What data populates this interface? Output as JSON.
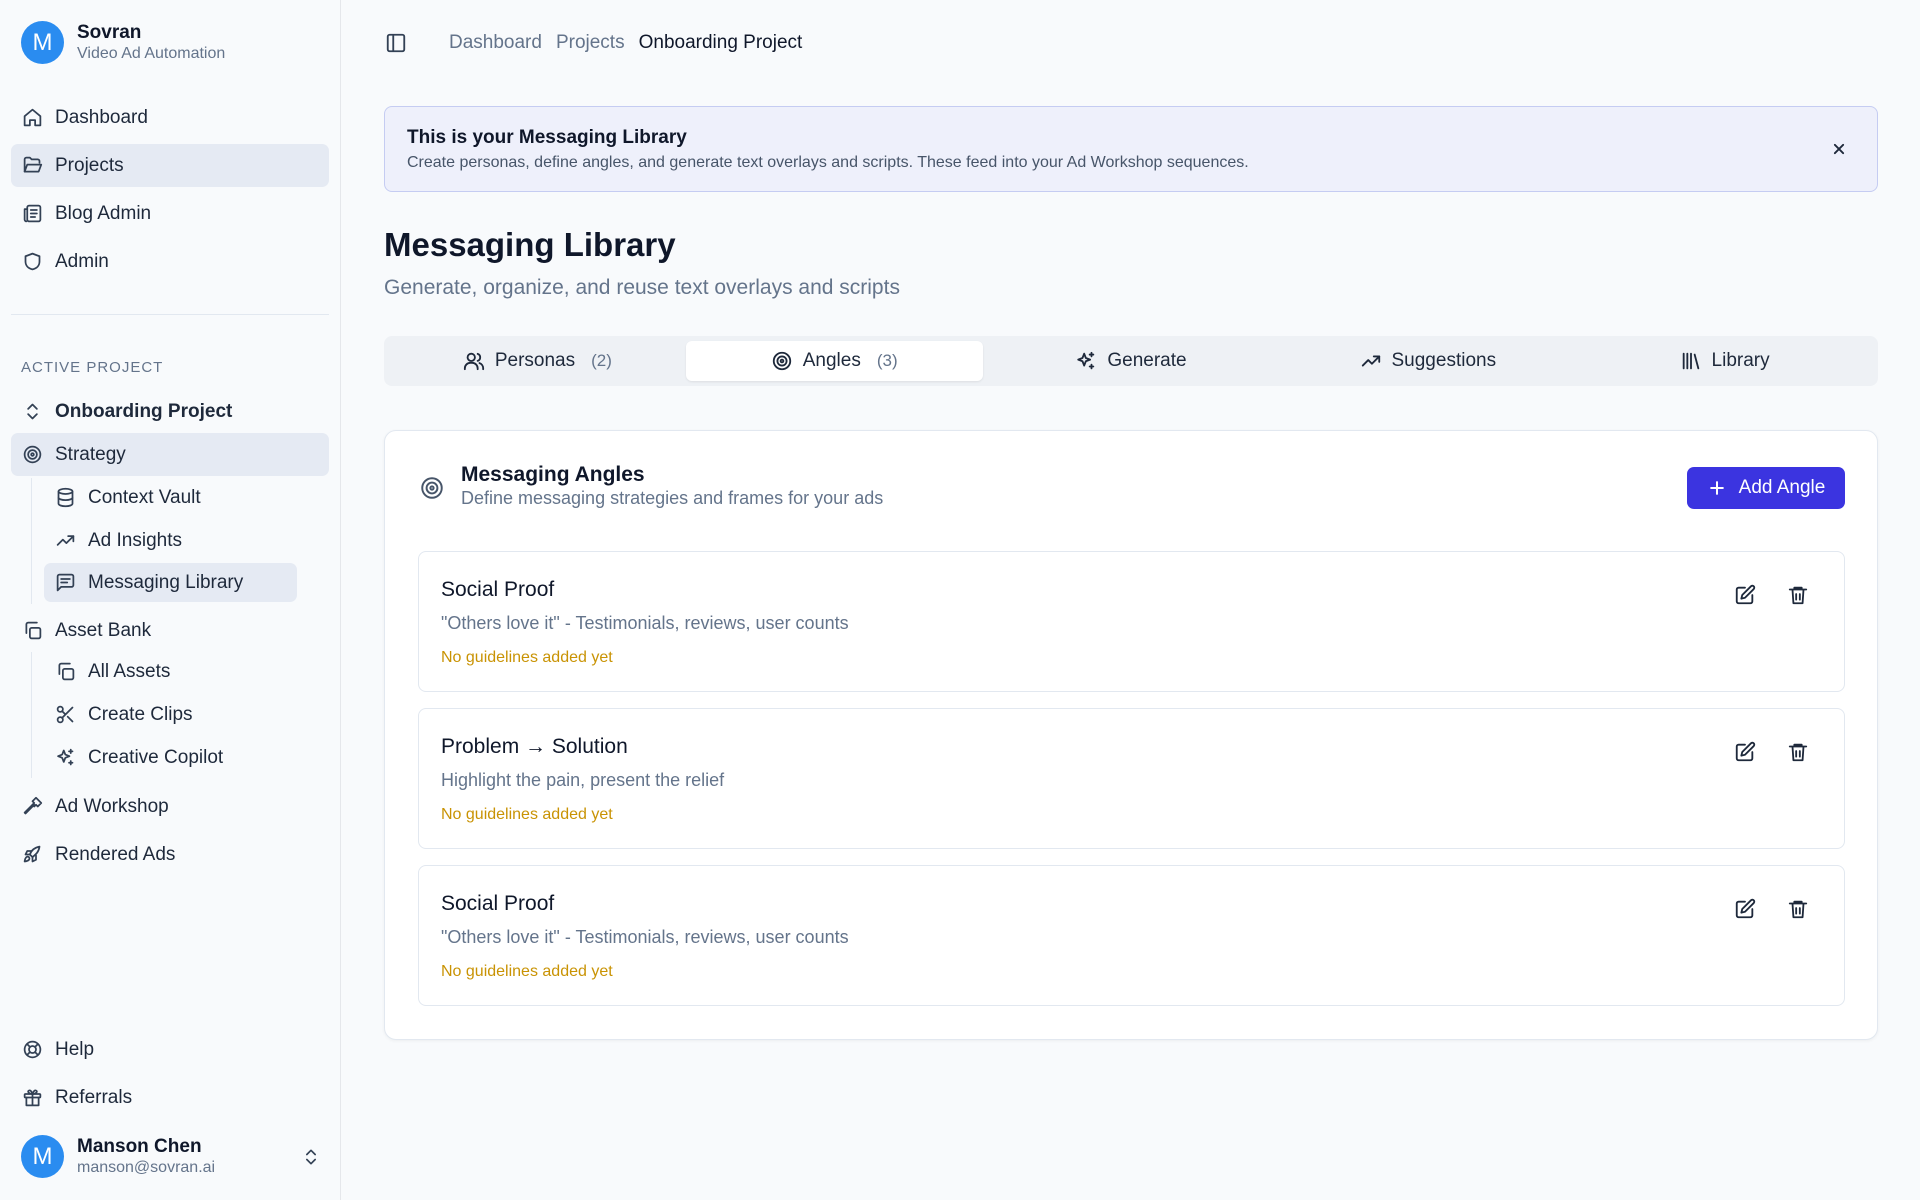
{
  "brand": {
    "initial": "M",
    "name": "Sovran",
    "subtitle": "Video Ad Automation"
  },
  "nav": {
    "dashboard": "Dashboard",
    "projects": "Projects",
    "blog_admin": "Blog Admin",
    "admin": "Admin"
  },
  "active_project": {
    "section_label": "ACTIVE PROJECT",
    "name": "Onboarding Project",
    "strategy": "Strategy",
    "strategy_items": [
      "Context Vault",
      "Ad Insights",
      "Messaging Library"
    ],
    "asset_bank": "Asset Bank",
    "asset_items": [
      "All Assets",
      "Create Clips",
      "Creative Copilot"
    ],
    "ad_workshop": "Ad Workshop",
    "rendered_ads": "Rendered Ads"
  },
  "footer_nav": {
    "help": "Help",
    "referrals": "Referrals"
  },
  "user": {
    "initial": "M",
    "name": "Manson Chen",
    "email": "manson@sovran.ai"
  },
  "breadcrumb": [
    "Dashboard",
    "Projects",
    "Onboarding Project"
  ],
  "banner": {
    "title": "This is your Messaging Library",
    "description": "Create personas, define angles, and generate text overlays and scripts. These feed into your Ad Workshop sequences."
  },
  "page": {
    "title": "Messaging Library",
    "subtitle": "Generate, organize, and reuse text overlays and scripts"
  },
  "tabs": [
    {
      "label": "Personas",
      "count": "(2)",
      "icon": "users-icon"
    },
    {
      "label": "Angles",
      "count": "(3)",
      "icon": "target-icon"
    },
    {
      "label": "Generate",
      "count": "",
      "icon": "sparkles-icon"
    },
    {
      "label": "Suggestions",
      "count": "",
      "icon": "trending-up-icon"
    },
    {
      "label": "Library",
      "count": "",
      "icon": "library-icon"
    }
  ],
  "angles_card": {
    "title": "Messaging Angles",
    "subtitle": "Define messaging strategies and frames for your ads",
    "add_label": "Add Angle",
    "items": [
      {
        "name": "Social Proof",
        "description": "\"Others love it\" - Testimonials, reviews, user counts",
        "note": "No guidelines added yet"
      },
      {
        "name": "Problem → Solution",
        "description": "Highlight the pain, present the relief",
        "note": "No guidelines added yet"
      },
      {
        "name": "Social Proof",
        "description": "\"Others love it\" - Testimonials, reviews, user counts",
        "note": "No guidelines added yet"
      }
    ]
  },
  "colors": {
    "accent": "#3b34e0",
    "avatar": "#2a8cf0",
    "warning_text": "#c99304",
    "banner_bg": "#eef0fb"
  }
}
